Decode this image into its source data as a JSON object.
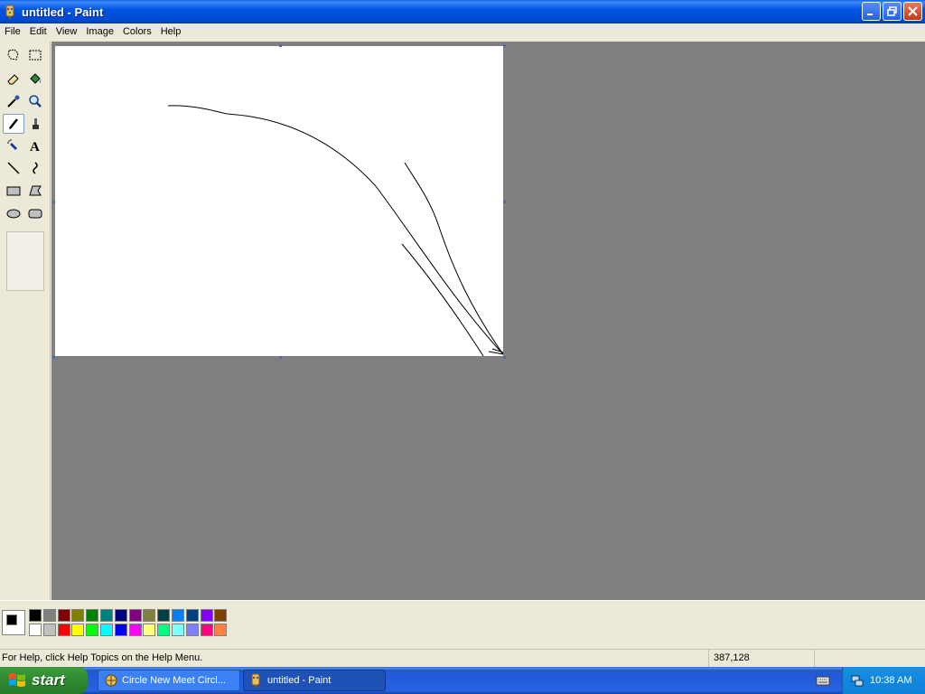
{
  "window": {
    "title": "untitled - Paint"
  },
  "menu": [
    "File",
    "Edit",
    "View",
    "Image",
    "Colors",
    "Help"
  ],
  "tools": [
    {
      "name": "free-form-select",
      "icon": "free-select-icon"
    },
    {
      "name": "select",
      "icon": "rect-select-icon"
    },
    {
      "name": "eraser",
      "icon": "eraser-icon"
    },
    {
      "name": "fill-with-color",
      "icon": "paint-bucket-icon"
    },
    {
      "name": "pick-color",
      "icon": "eyedropper-icon"
    },
    {
      "name": "magnifier",
      "icon": "magnifier-icon"
    },
    {
      "name": "pencil",
      "icon": "pencil-icon",
      "active": true
    },
    {
      "name": "brush",
      "icon": "brush-icon"
    },
    {
      "name": "airbrush",
      "icon": "airbrush-icon"
    },
    {
      "name": "text",
      "icon": "text-icon"
    },
    {
      "name": "line",
      "icon": "line-icon"
    },
    {
      "name": "curve",
      "icon": "curve-icon"
    },
    {
      "name": "rectangle",
      "icon": "rectangle-icon"
    },
    {
      "name": "polygon",
      "icon": "polygon-icon"
    },
    {
      "name": "ellipse",
      "icon": "ellipse-icon"
    },
    {
      "name": "rounded-rectangle",
      "icon": "rounded-rect-icon"
    }
  ],
  "palette": {
    "foreground": "#000000",
    "background": "#ffffff",
    "row1": [
      "#000000",
      "#808080",
      "#800000",
      "#808000",
      "#008000",
      "#008080",
      "#000080",
      "#800080",
      "#808040",
      "#004040",
      "#0080ff",
      "#004080",
      "#8000ff",
      "#804000"
    ],
    "row2": [
      "#ffffff",
      "#c0c0c0",
      "#ff0000",
      "#ffff00",
      "#00ff00",
      "#00ffff",
      "#0000ff",
      "#ff00ff",
      "#ffff80",
      "#00ff80",
      "#80ffff",
      "#8080ff",
      "#ff0080",
      "#ff8040"
    ]
  },
  "status": {
    "help_text": "For Help, click Help Topics on the Help Menu.",
    "coords": "387,128"
  },
  "taskbar": {
    "start_label": "start",
    "tasks": [
      {
        "label": "Circle New Meet Circl...",
        "active": false
      },
      {
        "label": "untitled - Paint",
        "active": true
      }
    ],
    "clock": "10:38 AM"
  }
}
